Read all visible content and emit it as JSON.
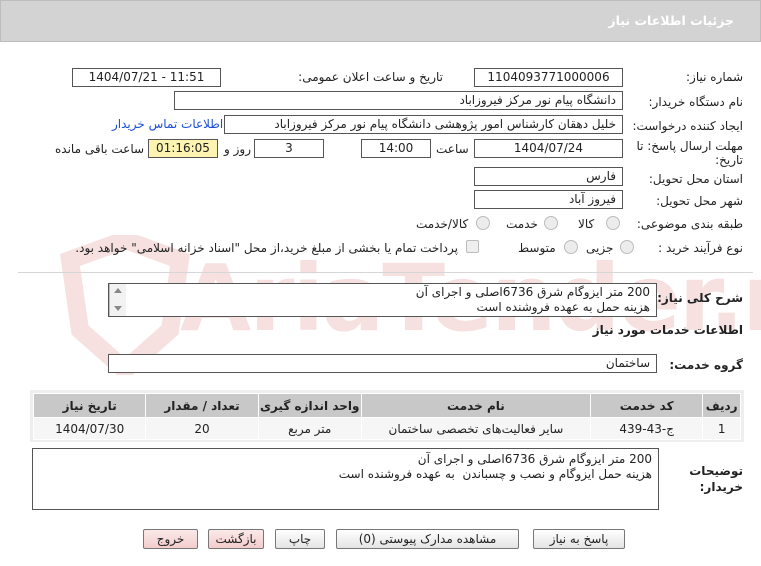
{
  "header": {
    "title": "جزئیات اطلاعات نیاز"
  },
  "fields": {
    "need_number_label": "شماره نیاز:",
    "need_number": "1104093771000006",
    "announce_label": "تاریخ و ساعت اعلان عمومی:",
    "announce_value": "1404/07/21 - 11:51",
    "buyer_label": "نام دستگاه خریدار:",
    "buyer_value": "دانشگاه پیام نور مرکز فیروزاباد",
    "creator_label": "ایجاد کننده درخواست:",
    "creator_value": "خلیل دهقان کارشناس امور پژوهشی دانشگاه پیام نور مرکز فیروزاباد",
    "contact_link": "اطلاعات تماس خریدار",
    "deadline_label_1": "مهلت ارسال پاسخ: تا",
    "deadline_label_2": "تاریخ:",
    "deadline_date": "1404/07/24",
    "time_label": "ساعت",
    "deadline_time": "14:00",
    "days_value": "3",
    "days_label": "روز و",
    "remaining_value": "01:16:05",
    "remaining_label": "ساعت باقی مانده",
    "province_label": "استان محل تحویل:",
    "province_value": "فارس",
    "city_label": "شهر محل تحویل:",
    "city_value": "فیروز آباد",
    "category_label": "طبقه بندی موضوعی:",
    "category_options": [
      "کالا",
      "خدمت",
      "کالا/خدمت"
    ],
    "process_label": "نوع فرآیند خرید :",
    "process_options": [
      "جزیی",
      "متوسط"
    ],
    "payment_note": "پرداخت تمام یا بخشی از مبلغ خرید،از محل \"اسناد خزانه اسلامی\" خواهد بود."
  },
  "general_desc": {
    "label": "شرح کلی نیاز:",
    "line1": "200 متر ایزوگام شرق 6736اصلی و اجرای آن",
    "line2": "هزینه حمل به عهده فروشنده است"
  },
  "services": {
    "section_title": "اطلاعات خدمات مورد نیاز",
    "group_label": "گروه خدمت:",
    "group_value": "ساختمان",
    "columns": [
      "ردیف",
      "کد خدمت",
      "نام خدمت",
      "واحد اندازه گیری",
      "تعداد / مقدار",
      "تاریخ نیاز"
    ],
    "rows": [
      [
        "1",
        "ج-43-439",
        "سایر فعالیت‌های تخصصی ساختمان",
        "متر مربع",
        "20",
        "1404/07/30"
      ]
    ]
  },
  "buyer_notes": {
    "label_1": "توضیحات",
    "label_2": "خریدار:",
    "line1": "200 متر ایزوگام شرق 6736اصلی و اجرای آن",
    "line2": "هزینه حمل ایزوگام و نصب و چسباندن  به عهده فروشنده است"
  },
  "buttons": {
    "reply": "پاسخ به نیاز",
    "docs": "مشاهده مدارک پیوستی (0)",
    "print": "چاپ",
    "back": "بازگشت",
    "exit": "خروج"
  },
  "watermark": {
    "text": "AriaTender.net"
  }
}
